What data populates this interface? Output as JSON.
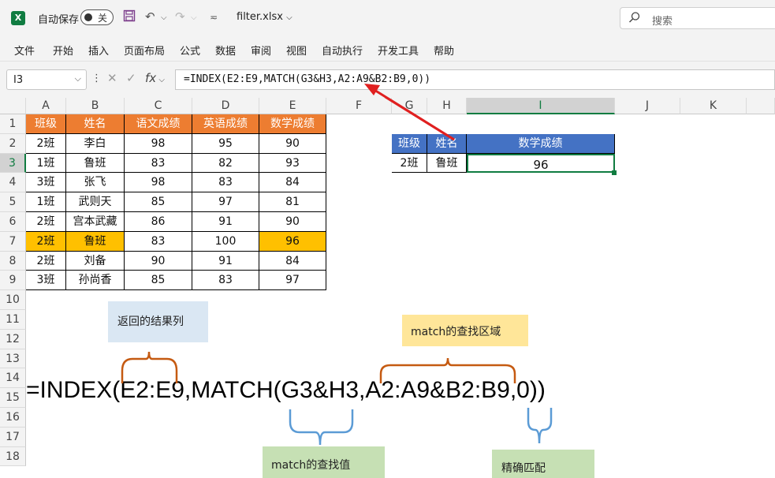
{
  "titlebar": {
    "app_icon": "X",
    "autosave_label": "自动保存",
    "autosave_state": "关",
    "filename": "filter.xlsx",
    "filename_arrow": "⌵",
    "search_placeholder": "搜索"
  },
  "menu": [
    "文件",
    "开始",
    "插入",
    "页面布局",
    "公式",
    "数据",
    "审阅",
    "视图",
    "自动执行",
    "开发工具",
    "帮助"
  ],
  "formula_bar": {
    "name_box": "I3",
    "formula": "=INDEX(E2:E9,MATCH(G3&H3,A2:A9&B2:B9,0))"
  },
  "columns": [
    "A",
    "B",
    "C",
    "D",
    "E",
    "F",
    "G",
    "H",
    "I",
    "J",
    "K"
  ],
  "rows": [
    "1",
    "2",
    "3",
    "4",
    "5",
    "6",
    "7",
    "8",
    "9",
    "10",
    "11",
    "12",
    "13",
    "14",
    "15",
    "16",
    "17",
    "18"
  ],
  "table": {
    "header": [
      "班级",
      "姓名",
      "语文成绩",
      "英语成绩",
      "数学成绩"
    ],
    "rows": [
      [
        "2班",
        "李白",
        "98",
        "95",
        "90"
      ],
      [
        "1班",
        "鲁班",
        "83",
        "82",
        "93"
      ],
      [
        "3班",
        "张飞",
        "98",
        "83",
        "84"
      ],
      [
        "1班",
        "武则天",
        "85",
        "97",
        "81"
      ],
      [
        "2班",
        "宫本武藏",
        "86",
        "91",
        "90"
      ],
      [
        "2班",
        "鲁班",
        "83",
        "100",
        "96"
      ],
      [
        "2班",
        "刘备",
        "90",
        "91",
        "84"
      ],
      [
        "3班",
        "孙尚香",
        "85",
        "83",
        "97"
      ]
    ]
  },
  "lookup": {
    "header": [
      "班级",
      "姓名",
      "数学成绩"
    ],
    "values": [
      "2班",
      "鲁班",
      "96"
    ]
  },
  "annotations": {
    "result_col": "返回的结果列",
    "match_range": "match的查找区域",
    "match_value": "match的查找值",
    "exact_match": "精确匹配",
    "big_formula": "=INDEX(E2:E9,MATCH(G3&H3,A2:A9&B2:B9,0))"
  },
  "colors": {
    "header_orange": "#ed7d31",
    "highlight_gold": "#ffc000",
    "lookup_blue": "#4472c4",
    "excel_green": "#107c41"
  }
}
